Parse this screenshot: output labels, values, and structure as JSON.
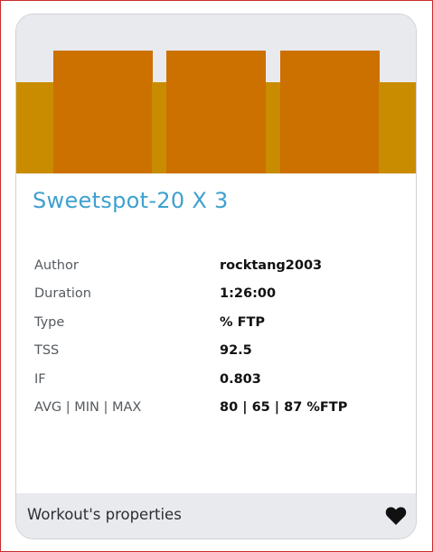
{
  "workout": {
    "title": "Sweetspot-20 X 3",
    "profile": {
      "colors": {
        "background": "#e9eaee",
        "low": "#c98c00",
        "high": "#cc7000"
      },
      "segments": [
        {
          "duration_s": 450,
          "intensity_pct": 65
        },
        {
          "duration_s": 1200,
          "intensity_pct": 87
        },
        {
          "duration_s": 180,
          "intensity_pct": 65
        },
        {
          "duration_s": 1200,
          "intensity_pct": 87
        },
        {
          "duration_s": 180,
          "intensity_pct": 65
        },
        {
          "duration_s": 1200,
          "intensity_pct": 87
        },
        {
          "duration_s": 450,
          "intensity_pct": 65
        }
      ],
      "max_intensity_pct": 100
    },
    "properties": [
      {
        "label": "Author",
        "value": "rocktang2003"
      },
      {
        "label": "Duration",
        "value": "1:26:00"
      },
      {
        "label": "Type",
        "value": "% FTP"
      },
      {
        "label": "TSS",
        "value": "92.5"
      },
      {
        "label": "IF",
        "value": "0.803"
      },
      {
        "label": "AVG | MIN | MAX",
        "value": "80 | 65 | 87 %FTP"
      }
    ]
  },
  "footer": {
    "label": "Workout's properties",
    "favorite_icon": "heart-icon"
  }
}
